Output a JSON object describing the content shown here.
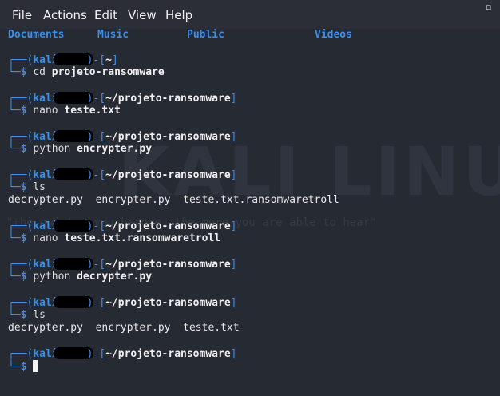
{
  "menu": {
    "file": "File",
    "actions": "Actions",
    "edit": "Edit",
    "view": "View",
    "help": "Help"
  },
  "directories": [
    "Documents",
    "Music",
    "Public",
    "Videos"
  ],
  "prompt": {
    "top_prefix": "┌──(",
    "user": "kali",
    "sep": ")-[",
    "close": "]",
    "bottom_prefix": "└─",
    "dollar": "$"
  },
  "blocks": [
    {
      "path": "~",
      "cmd": "cd",
      "arg": "projeto-ransomware",
      "output": ""
    },
    {
      "path": "~/projeto-ransomware",
      "cmd": "nano",
      "arg": "teste.txt",
      "output": ""
    },
    {
      "path": "~/projeto-ransomware",
      "cmd": "python",
      "arg": "encrypter.py",
      "output": ""
    },
    {
      "path": "~/projeto-ransomware",
      "cmd": "ls",
      "arg": "",
      "output": "decrypter.py  encrypter.py  teste.txt.ransomwaretroll"
    },
    {
      "path": "~/projeto-ransomware",
      "cmd": "nano",
      "arg": "teste.txt.ransomwaretroll",
      "output": ""
    },
    {
      "path": "~/projeto-ransomware",
      "cmd": "python",
      "arg": "decrypter.py",
      "output": ""
    },
    {
      "path": "~/projeto-ransomware",
      "cmd": "ls",
      "arg": "",
      "output": "decrypter.py  encrypter.py  teste.txt"
    },
    {
      "path": "~/projeto-ransomware",
      "cmd": "",
      "arg": "",
      "output": ""
    }
  ],
  "watermark": {
    "logo": "KALI LINUX",
    "tagline": "\"the quieter you become, the more you are able to hear\""
  },
  "colors": {
    "background": "#262a33",
    "menubar": "#2b2e37",
    "prompt_blue": "#3b8eea",
    "text": "#e8e8e8"
  }
}
